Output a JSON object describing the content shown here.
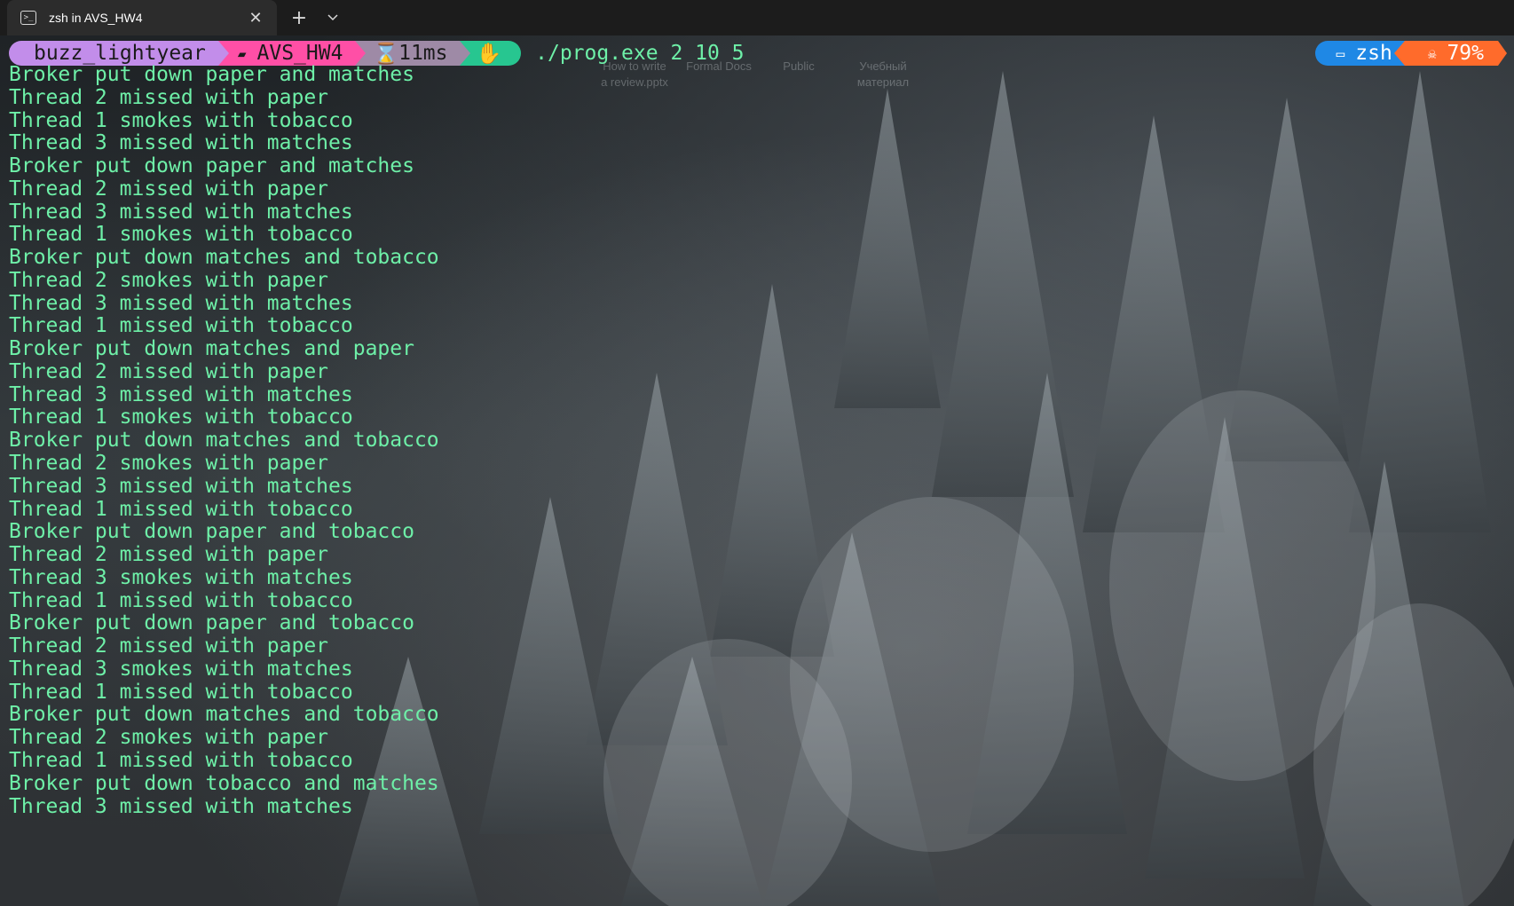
{
  "window": {
    "tab_title": "zsh in AVS_HW4",
    "tab_icon": "terminal-icon",
    "close_glyph": "✕",
    "new_tab_glyph": "+"
  },
  "prompt": {
    "user": "buzz_lightyear",
    "directory": "AVS_HW4",
    "directory_icon": "folder-icon",
    "duration": "11ms",
    "duration_icon": "hourglass-icon",
    "status_icon": "hand-icon",
    "command": "./prog.exe 2 10 5",
    "shell": "zsh",
    "shell_icon": "terminal-icon",
    "battery": "79%",
    "battery_icon": "skull-icon"
  },
  "desktop_ghosts": {
    "label1": "How to write\na review.pptx",
    "label2": "Formal Docs",
    "label3": "Public",
    "label4": "Учебный\nматериал"
  },
  "colors": {
    "output_text": "#6ef0a8",
    "user_segment": "#c28dea",
    "dir_segment": "#ff4fa6",
    "time_segment": "#9e8aa6",
    "status_segment": "#27c690",
    "shell_segment": "#1f88e5",
    "battery_segment": "#ff6b2b"
  },
  "output_lines": [
    "Broker put down paper and matches",
    "Thread 2 missed with paper",
    "Thread 1 smokes with tobacco",
    "Thread 3 missed with matches",
    "Broker put down paper and matches",
    "Thread 2 missed with paper",
    "Thread 3 missed with matches",
    "Thread 1 smokes with tobacco",
    "Broker put down matches and tobacco",
    "Thread 2 smokes with paper",
    "Thread 3 missed with matches",
    "Thread 1 missed with tobacco",
    "Broker put down matches and paper",
    "Thread 2 missed with paper",
    "Thread 3 missed with matches",
    "Thread 1 smokes with tobacco",
    "Broker put down matches and tobacco",
    "Thread 2 smokes with paper",
    "Thread 3 missed with matches",
    "Thread 1 missed with tobacco",
    "Broker put down paper and tobacco",
    "Thread 2 missed with paper",
    "Thread 3 smokes with matches",
    "Thread 1 missed with tobacco",
    "Broker put down paper and tobacco",
    "Thread 2 missed with paper",
    "Thread 3 smokes with matches",
    "Thread 1 missed with tobacco",
    "Broker put down matches and tobacco",
    "Thread 2 smokes with paper",
    "Thread 1 missed with tobacco",
    "Broker put down tobacco and matches",
    "Thread 3 missed with matches"
  ]
}
